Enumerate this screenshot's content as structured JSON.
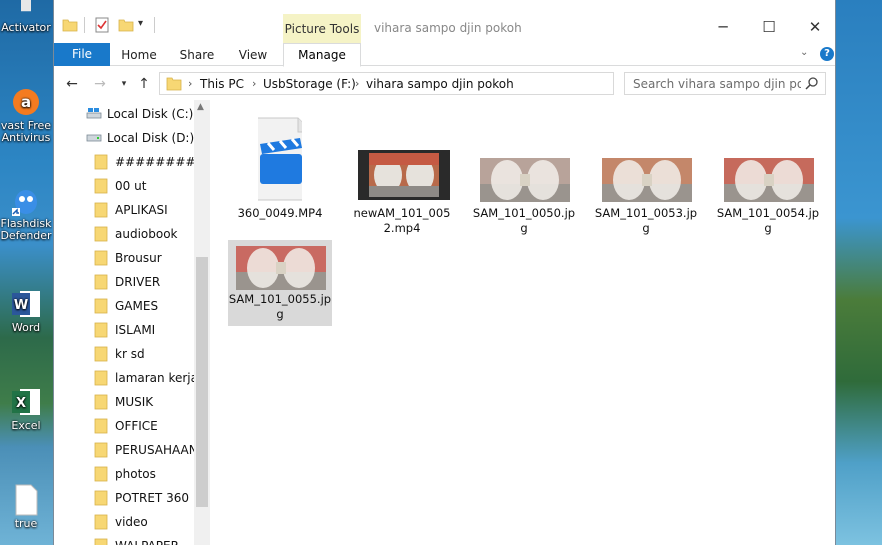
{
  "desktop": {
    "icons": [
      {
        "label": "Activator",
        "icon": "activator-icon"
      },
      {
        "label": "Avast Free Antivirus",
        "line1": "vast Free",
        "line2": "Antivirus",
        "icon": "avast-icon"
      },
      {
        "label": "Flashdisk Defender",
        "line1": "Flashdisk",
        "line2": "Defender",
        "icon": "flashdisk-defender-icon"
      },
      {
        "label": "Word",
        "icon": "word-icon"
      },
      {
        "label": "Excel",
        "icon": "excel-icon"
      },
      {
        "label": "true",
        "icon": "file-icon"
      }
    ]
  },
  "window": {
    "title": "vihara sampo djin pokoh",
    "context_tab_group": "Picture Tools",
    "tabs": {
      "file": "File",
      "home": "Home",
      "share": "Share",
      "view": "View",
      "manage": "Manage"
    },
    "controls": {
      "minimize": "─",
      "maximize": "☐",
      "close": "✕"
    }
  },
  "address": {
    "crumbs": [
      "This PC",
      "UsbStorage (F:)",
      "vihara sampo djin pokoh"
    ],
    "search_placeholder": "Search vihara sampo djin pok"
  },
  "nav_pane": {
    "items": [
      {
        "label": "Local Disk (C:)",
        "type": "drive"
      },
      {
        "label": "Local Disk (D:)",
        "type": "drive"
      },
      {
        "label": "###########",
        "type": "folder"
      },
      {
        "label": "00 ut",
        "type": "folder"
      },
      {
        "label": "APLIKASI",
        "type": "folder"
      },
      {
        "label": "audiobook",
        "type": "folder"
      },
      {
        "label": "Brousur",
        "type": "folder"
      },
      {
        "label": "DRIVER",
        "type": "folder"
      },
      {
        "label": "GAMES",
        "type": "folder"
      },
      {
        "label": "ISLAMI",
        "type": "folder"
      },
      {
        "label": "kr sd",
        "type": "folder"
      },
      {
        "label": "lamaran kerja",
        "type": "folder"
      },
      {
        "label": "MUSIK",
        "type": "folder"
      },
      {
        "label": "OFFICE",
        "type": "folder"
      },
      {
        "label": "PERUSAHAANI",
        "type": "folder"
      },
      {
        "label": "photos",
        "type": "folder"
      },
      {
        "label": "POTRET 360",
        "type": "folder"
      },
      {
        "label": "video",
        "type": "folder"
      },
      {
        "label": "WALPAPER",
        "type": "folder"
      }
    ]
  },
  "files": [
    {
      "name": "360_0049.MP4",
      "l1": "360_0049.MP4",
      "l2": "",
      "l3": "",
      "kind": "video-file",
      "selected": false
    },
    {
      "name": "newAM_101_0052.mp4",
      "l1": "newAM_101_005",
      "l2": "2.mp4",
      "l3": "",
      "kind": "video-thumb",
      "selected": false
    },
    {
      "name": "SAM_101_0050.jpg",
      "l1": "SAM_101_0050.jp",
      "l2": "g",
      "l3": "",
      "kind": "image",
      "selected": false
    },
    {
      "name": "SAM_101_0053.jpg",
      "l1": "SAM_101_0053.jp",
      "l2": "g",
      "l3": "",
      "kind": "image",
      "selected": false
    },
    {
      "name": "SAM_101_0054.jpg",
      "l1": "SAM_101_0054.jp",
      "l2": "g",
      "l3": "",
      "kind": "image",
      "selected": false
    },
    {
      "name": "SAM_101_0055.jpg",
      "l1": "SAM_101_0055.jp",
      "l2": "g",
      "l3": "",
      "kind": "image",
      "selected": true
    }
  ],
  "colors": {
    "file_tab": "#1979ca",
    "picture_tools": "#f5f3c6",
    "selection": "#d9d9d9",
    "folder": "#f7d774"
  }
}
